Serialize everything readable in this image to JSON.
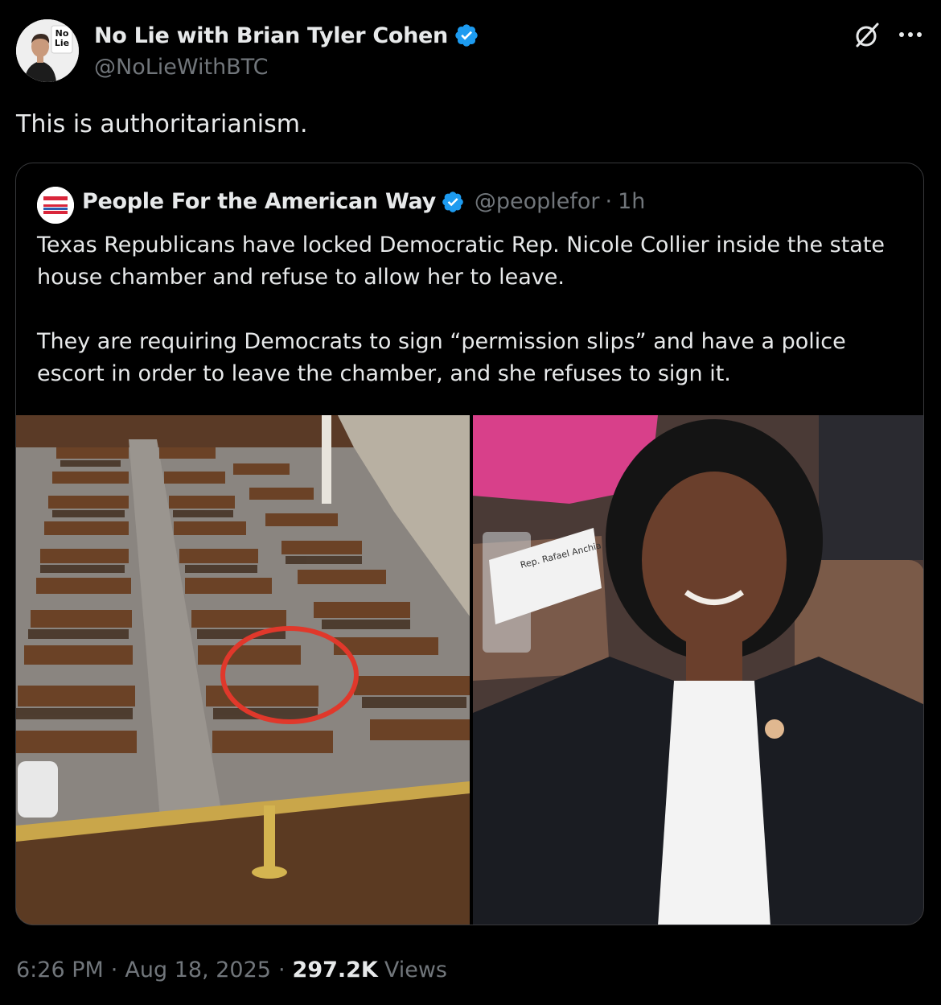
{
  "author": {
    "name": "No Lie with Brian Tyler Cohen",
    "handle": "@NoLieWithBTC",
    "avatar_icon": "avatar-photo",
    "avatar_badge": [
      "No",
      "Lie"
    ]
  },
  "tweet_text": "This is authoritarianism.",
  "quoted_tweet": {
    "name": "People For the American Way",
    "handle": "@peoplefor",
    "dot": "·",
    "time": "1h",
    "paragraph_1": "Texas Republicans have locked Democratic Rep. Nicole Collier inside the state house chamber and refuse to allow her to leave.",
    "paragraph_2": "They are requiring Democrats to sign “permission slips” and have a police escort in order to leave the chamber, and she refuses to sign it.",
    "images": [
      "house-chamber-photo",
      "portrait-photo"
    ],
    "nameplate_text": "Rep. Rafael Anchia"
  },
  "footer": {
    "time": "6:26 PM",
    "sep1": "·",
    "date": "Aug 18, 2025",
    "sep2": "·",
    "views_count": "297.2K",
    "views_label": "Views"
  },
  "colors": {
    "background": "#000000",
    "text": "#e7e9ea",
    "secondary": "#71767b",
    "verified": "#1d9bf0",
    "border": "#38393c",
    "highlight_circle": "#e0382b"
  }
}
